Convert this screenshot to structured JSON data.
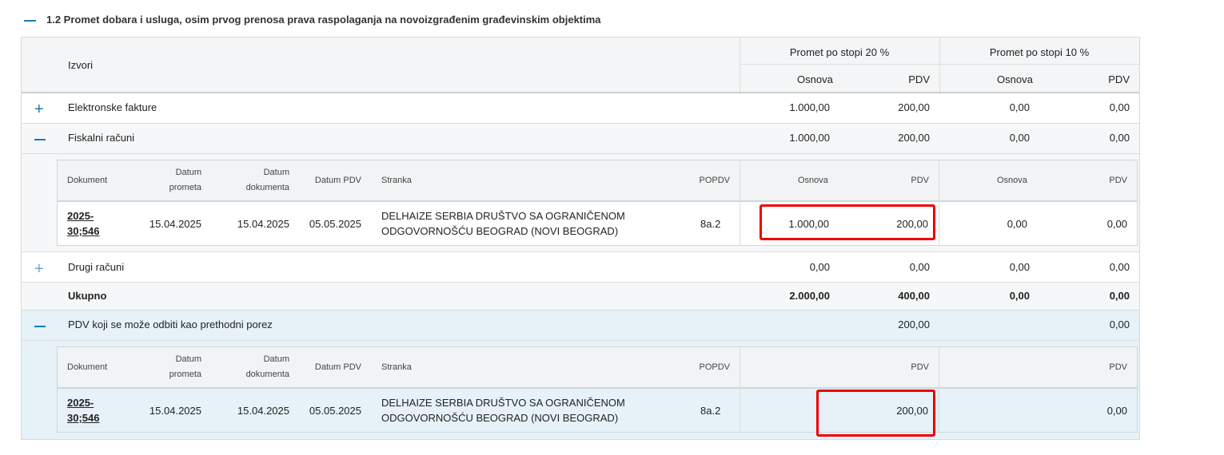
{
  "section": {
    "title": "1.2 Promet dobara i usluga, osim prvog prenosa prava raspolaganja na novoizgrađenim građevinskim objektima"
  },
  "header": {
    "sources": "Izvori",
    "group20": "Promet po stopi 20 %",
    "group10": "Promet po stopi 10 %",
    "base": "Osnova",
    "vat": "PDV"
  },
  "rows": {
    "einvoice": {
      "label": "Elektronske fakture",
      "b20": "1.000,00",
      "v20": "200,00",
      "b10": "0,00",
      "v10": "0,00"
    },
    "fiscal": {
      "label": "Fiskalni računi",
      "b20": "1.000,00",
      "v20": "200,00",
      "b10": "0,00",
      "v10": "0,00"
    },
    "other": {
      "label": "Drugi računi",
      "b20": "0,00",
      "v20": "0,00",
      "b10": "0,00",
      "v10": "0,00"
    },
    "total": {
      "label": "Ukupno",
      "b20": "2.000,00",
      "v20": "400,00",
      "b10": "0,00",
      "v10": "0,00"
    },
    "deductible": {
      "label": "PDV koji se može odbiti kao prethodni porez",
      "v20": "200,00",
      "v10": "0,00"
    }
  },
  "detail_header": {
    "doc": "Dokument",
    "date_turnover_1": "Datum",
    "date_turnover_2": "prometa",
    "date_doc_1": "Datum",
    "date_doc_2": "dokumenta",
    "date_vat": "Datum PDV",
    "party": "Stranka",
    "popdv": "POPDV",
    "base": "Osnova",
    "vat": "PDV"
  },
  "fiscal_detail": {
    "doc_1": "2025-",
    "doc_2": "30;546",
    "date_turnover": "15.04.2025",
    "date_doc": "15.04.2025",
    "date_vat": "05.05.2025",
    "party_1": "DELHAIZE SERBIA DRUŠTVO SA OGRANIČENOM",
    "party_2": "ODGOVORNOŠĆU BEOGRAD (NOVI BEOGRAD)",
    "popdv": "8a.2",
    "b20": "1.000,00",
    "v20": "200,00",
    "b10": "0,00",
    "v10": "0,00"
  },
  "deductible_detail": {
    "doc_1": "2025-",
    "doc_2": "30;546",
    "date_turnover": "15.04.2025",
    "date_doc": "15.04.2025",
    "date_vat": "05.05.2025",
    "party_1": "DELHAIZE SERBIA DRUŠTVO SA OGRANIČENOM",
    "party_2": "ODGOVORNOŠĆU BEOGRAD (NOVI BEOGRAD)",
    "popdv": "8a.2",
    "v20": "200,00",
    "v10": "0,00"
  },
  "colors": {
    "accent": "#1b7ab3",
    "highlight": "#ee0000",
    "row_tint": "#e6f2f7",
    "header_bg": "#f4f5f6"
  },
  "icons": {
    "collapse": "minus-icon",
    "expand": "plus-icon"
  }
}
